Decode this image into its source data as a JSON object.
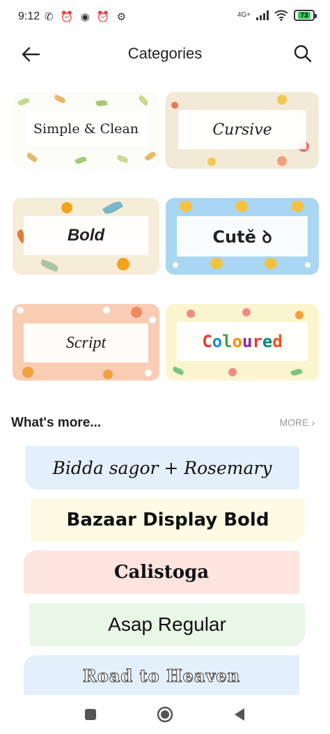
{
  "status": {
    "time": "9:12",
    "left_icons": "✆ ⏰ ◉ ⏰ ⚙",
    "network": "4G+",
    "battery": "73"
  },
  "app_bar": {
    "title": "Categories"
  },
  "categories": [
    {
      "label": "Simple & Clean"
    },
    {
      "label": "Cursive"
    },
    {
      "label": "Bold"
    },
    {
      "label": "Cutě ꝺ"
    },
    {
      "label": "Script"
    },
    {
      "label": "Coloured",
      "letter_colors": [
        "#e53935",
        "#1e88e5",
        "#43a047",
        "#fb8c00",
        "#8e24aa",
        "#e53935",
        "#00897b",
        "#f4511e"
      ]
    }
  ],
  "whats_more": {
    "title": "What's more...",
    "more_label": "MORE ›"
  },
  "fonts": [
    {
      "name": "Bidda sagor + Rosemary"
    },
    {
      "name": "Bazaar Display Bold"
    },
    {
      "name": "Calistoga"
    },
    {
      "name": "Asap Regular"
    },
    {
      "name": "Road to Heaven"
    }
  ],
  "colors": {
    "simple_bg": "#fbfcf5",
    "cursive_bg": "#f2ead6",
    "bold_bg": "#f6edd8",
    "cute_bg": "#a9d6f2",
    "script_bg": "#f8cdb3",
    "coloured_bg": "#fbf5cf"
  },
  "icons": {
    "back": "arrow-left-icon",
    "search": "search-icon",
    "nav_recent": "square-icon",
    "nav_home": "circle-icon",
    "nav_back": "triangle-icon"
  }
}
